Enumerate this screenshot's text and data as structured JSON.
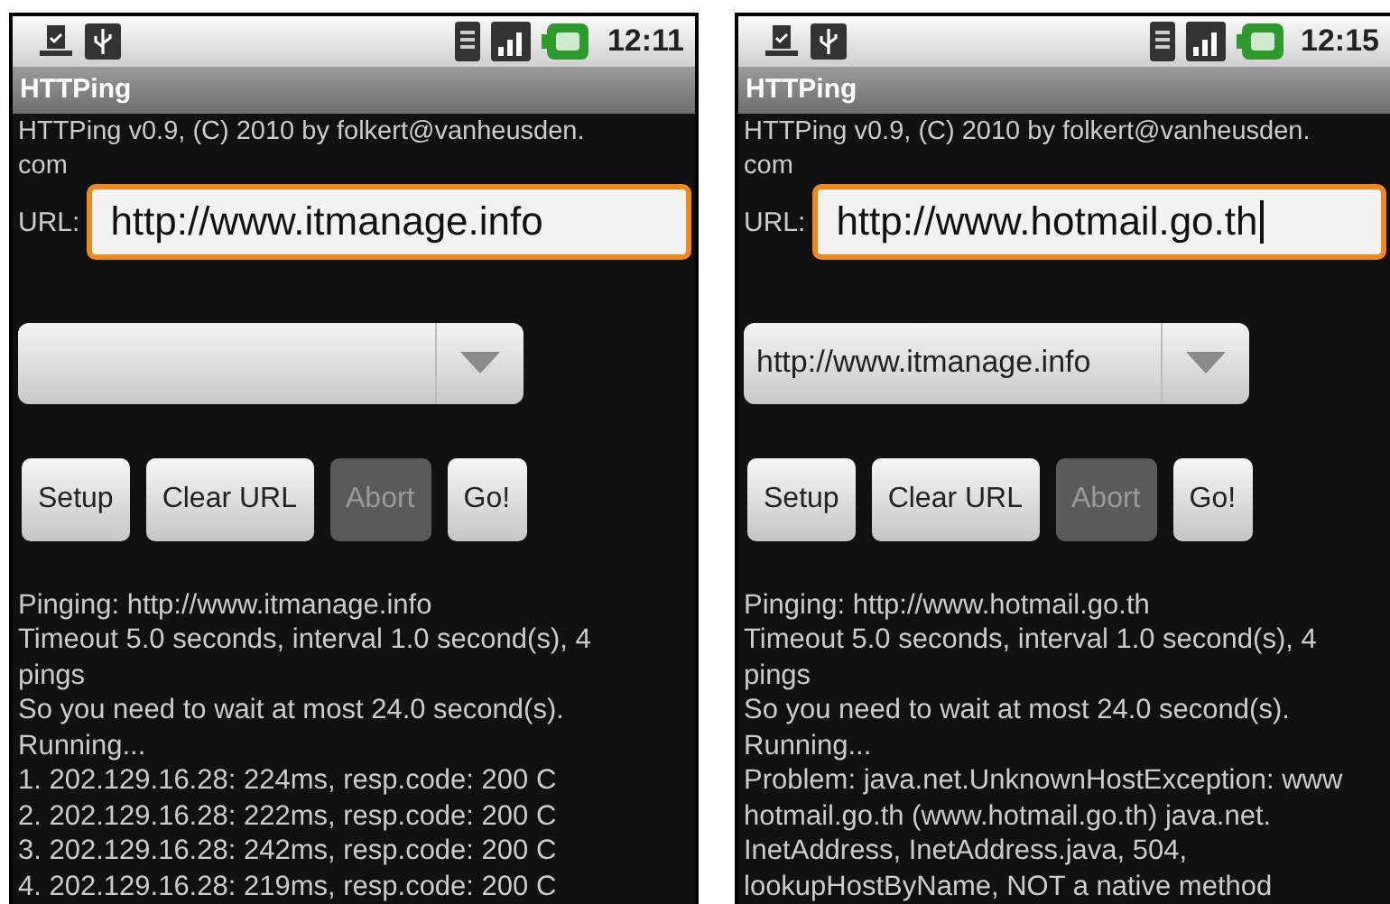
{
  "phones": [
    {
      "status_bar": {
        "time": "12:11"
      },
      "title": "HTTPing",
      "about": [
        "HTTPing v0.9, (C) 2010 by folkert@vanheusden.",
        "com"
      ],
      "url_field": {
        "label": "URL:",
        "value": "http://www.itmanage.info",
        "focused": true,
        "cursor": false
      },
      "buttons": [
        {
          "label": "Setup",
          "disabled": false
        },
        {
          "label": "Clear URL",
          "disabled": false
        },
        {
          "label": "Abort",
          "disabled": true
        },
        {
          "label": "Go!",
          "disabled": false
        }
      ],
      "log": [
        "Pinging: http://www.itmanage.info",
        "Timeout 5.0 seconds, interval 1.0 second(s), 4",
        "pings",
        "So you need to wait at most 24.0 second(s).",
        "Running...",
        "1. 202.129.16.28: 224ms, resp.code: 200 C",
        "2. 202.129.16.28: 222ms, resp.code: 200 C",
        "3. 202.129.16.28: 242ms, resp.code: 200 C",
        "4. 202.129.16.28: 219ms, resp.code: 200 C"
      ]
    },
    {
      "status_bar": {
        "time": "12:15"
      },
      "title": "HTTPing",
      "about": [
        "HTTPing v0.9, (C) 2010 by folkert@vanheusden.",
        "com"
      ],
      "url_field": {
        "label": "URL:",
        "value": "http://www.hotmail.go.th",
        "focused": true,
        "cursor": true
      },
      "spinner": {
        "value": "http://www.itmanage.info"
      },
      "buttons": [
        {
          "label": "Setup",
          "disabled": false
        },
        {
          "label": "Clear URL",
          "disabled": false
        },
        {
          "label": "Abort",
          "disabled": true
        },
        {
          "label": "Go!",
          "disabled": false
        }
      ],
      "log": [
        "Pinging: http://www.hotmail.go.th",
        "Timeout 5.0 seconds, interval 1.0 second(s), 4",
        "pings",
        "So you need to wait at most 24.0 second(s).",
        "Running...",
        "Problem: java.net.UnknownHostException: www",
        "hotmail.go.th (www.hotmail.go.th) java.net.",
        "InetAddress, InetAddress.java, 504,",
        "lookupHostByName, NOT a native method"
      ]
    }
  ]
}
